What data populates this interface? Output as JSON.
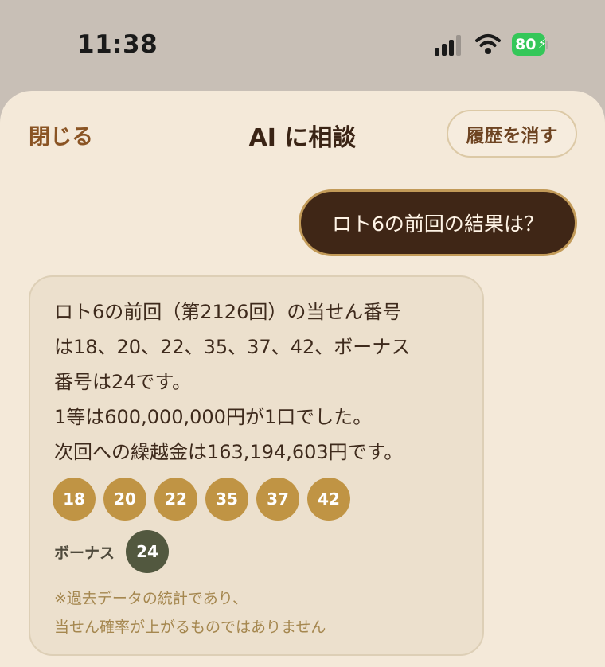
{
  "status_bar": {
    "time": "11:38",
    "battery_level": "80",
    "battery_color": "#34c759",
    "icons": [
      "cellular-signal-icon",
      "wifi-icon",
      "battery-charging-icon"
    ]
  },
  "header": {
    "close_label": "閉じる",
    "title": "AI に相談",
    "clear_history_label": "履歴を消す"
  },
  "chat": {
    "user_message": "ロト6の前回の結果は？",
    "ai_message": {
      "lines": [
        "ロト6の前回（第2126回）の当せん番号",
        "は18、20、22、35、37、42、ボーナス",
        "番号は24です。",
        "1等は600,000,000円が1口でした。",
        "次回への繰越金は163,194,603円です。"
      ],
      "numbers": [
        "18",
        "20",
        "22",
        "35",
        "37",
        "42"
      ],
      "bonus_label": "ボーナス",
      "bonus_number": "24",
      "disclaimer": [
        "※過去データの統計であり、",
        "当せん確率が上がるものではありません"
      ]
    }
  },
  "colors": {
    "sheet_bg": "#f4e9d9",
    "user_bubble_bg": "#3f2616",
    "ball": "#c09444",
    "bonus_ball": "#52583f",
    "accent_brown": "#8a5424"
  }
}
